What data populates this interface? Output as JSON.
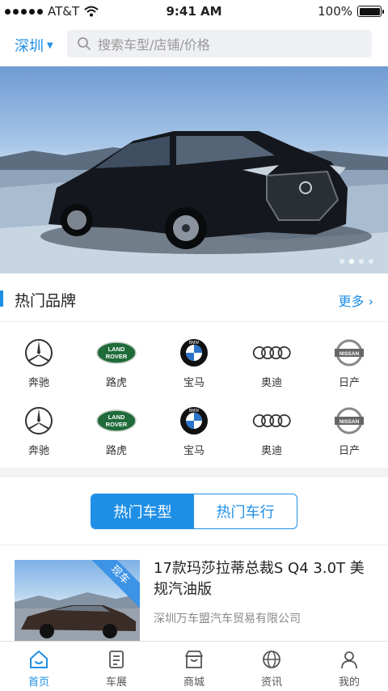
{
  "status": {
    "carrier": "AT&T",
    "time": "9:41 AM",
    "battery": "100%",
    "battery_level": 1.0
  },
  "header": {
    "city": "深圳",
    "search_placeholder": "搜索车型/店铺/价格"
  },
  "banner": {
    "slides": 4,
    "active_slide": 1
  },
  "hot_brands": {
    "title": "热门品牌",
    "more": "更多",
    "items": [
      {
        "name": "奔驰",
        "icon": "mercedes-logo-icon"
      },
      {
        "name": "路虎",
        "icon": "land-rover-logo-icon"
      },
      {
        "name": "宝马",
        "icon": "bmw-logo-icon"
      },
      {
        "name": "奥迪",
        "icon": "audi-logo-icon"
      },
      {
        "name": "日产",
        "icon": "nissan-logo-icon"
      },
      {
        "name": "奔驰",
        "icon": "mercedes-logo-icon"
      },
      {
        "name": "路虎",
        "icon": "land-rover-logo-icon"
      },
      {
        "name": "宝马",
        "icon": "bmw-logo-icon"
      },
      {
        "name": "奥迪",
        "icon": "audi-logo-icon"
      },
      {
        "name": "日产",
        "icon": "nissan-logo-icon"
      }
    ],
    "land_rover_text": [
      "LAND",
      "ROVER"
    ],
    "bmw_text": "BMW",
    "nissan_text": "NISSAN"
  },
  "segment": {
    "tabs": [
      "热门车型",
      "热门车行"
    ],
    "active": 0
  },
  "listing": {
    "ribbon": "现车",
    "title": "17款玛莎拉蒂总裁S Q4 3.0T 美规汽油版",
    "dealer": "深圳万车盟汽车贸易有限公司"
  },
  "tabbar": {
    "items": [
      {
        "label": "首页",
        "icon": "home-icon"
      },
      {
        "label": "车展",
        "icon": "car-show-icon"
      },
      {
        "label": "商城",
        "icon": "store-icon"
      },
      {
        "label": "资讯",
        "icon": "globe-icon"
      },
      {
        "label": "我的",
        "icon": "user-icon"
      }
    ],
    "active": 0
  },
  "colors": {
    "accent": "#1f8fe6",
    "background": "#f2f3f5"
  }
}
